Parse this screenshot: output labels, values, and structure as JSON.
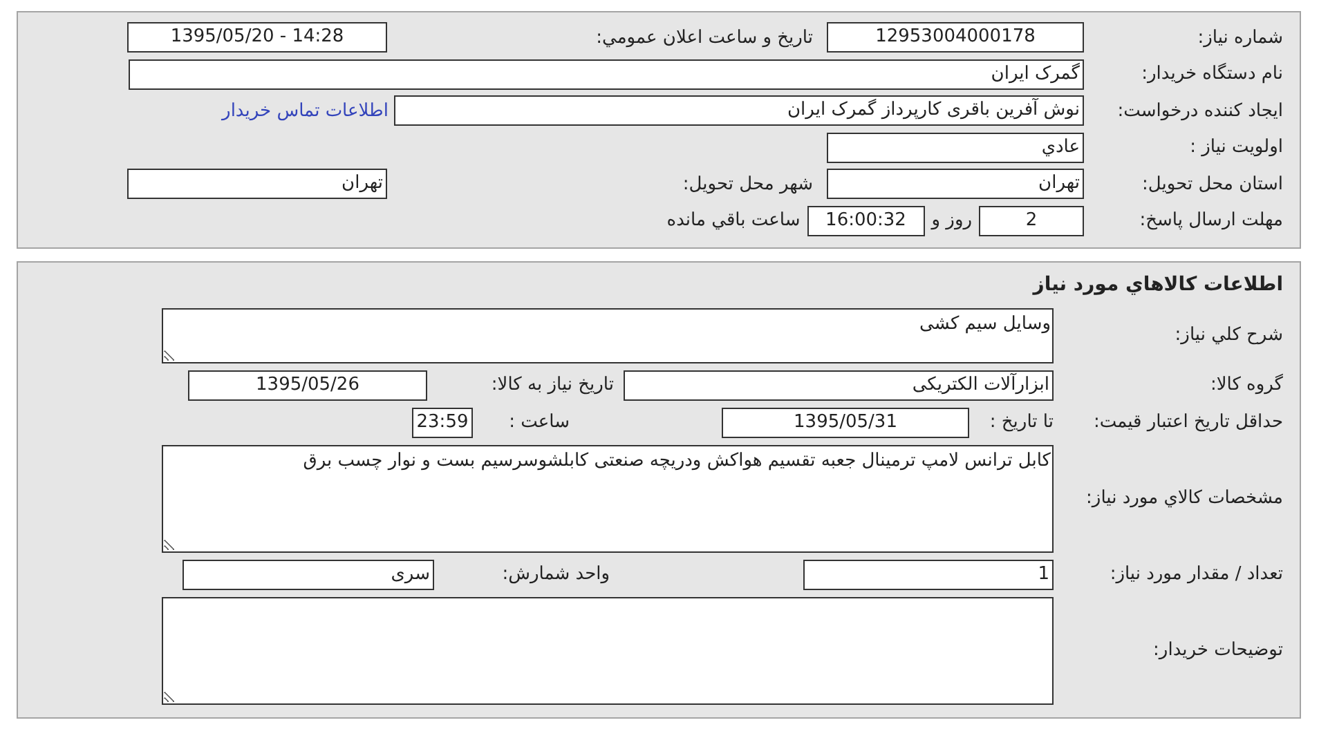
{
  "request_info": {
    "need_number": {
      "label": "شماره نیاز:",
      "value": "12953004000178"
    },
    "announce_datetime": {
      "label": "تاریخ و ساعت اعلان عمومي:",
      "value": "1395/05/20 - 14:28"
    },
    "buyer_org": {
      "label": "نام دستگاه خریدار:",
      "value": "گمرک ایران"
    },
    "requester": {
      "label": "ایجاد کننده درخواست:",
      "value": "نوش آفرین باقری کارپرداز گمرک ایران"
    },
    "contact_link": "اطلاعات تماس خریدار",
    "priority": {
      "label": "اولویت نیاز :",
      "value": "عادي"
    },
    "province": {
      "label": "استان محل تحویل:",
      "value": "تهران"
    },
    "city": {
      "label": "شهر محل تحویل:",
      "value": "تهران"
    },
    "deadline": {
      "label": "مهلت ارسال پاسخ:",
      "days": "2",
      "days_unit": "روز و",
      "time": "16:00:32",
      "time_unit": "ساعت باقي مانده"
    }
  },
  "goods": {
    "title": "اطلاعات كالاهاي مورد نیاز",
    "general_description": {
      "label": "شرح كلي نیاز:",
      "value": "وسایل سیم کشی"
    },
    "goods_group": {
      "label": "گروه كالا:",
      "value": "ابزارآلات الکتریکی"
    },
    "need_date": {
      "label": "تاریخ نیاز به كالا:",
      "value": "1395/05/26"
    },
    "price_validity": {
      "label": "حداقل تاریخ اعتبار قیمت:",
      "date_label": "تا تاریخ :",
      "date": "1395/05/31",
      "time_label": "ساعت :",
      "time": "23:59"
    },
    "specs": {
      "label": "مشخصات كالاي مورد نیاز:",
      "value": "كابل ترانس لامپ ترمینال جعبه تقسیم هواکش ودریچه صنعتی کابلشوسرسیم بست و نوار چسب برق"
    },
    "quantity": {
      "label": "تعداد / مقدار مورد نیاز:",
      "value": "1"
    },
    "unit": {
      "label": "واحد شمارش:",
      "value": "سری"
    },
    "buyer_notes": {
      "label": "توضیحات خریدار:"
    }
  }
}
